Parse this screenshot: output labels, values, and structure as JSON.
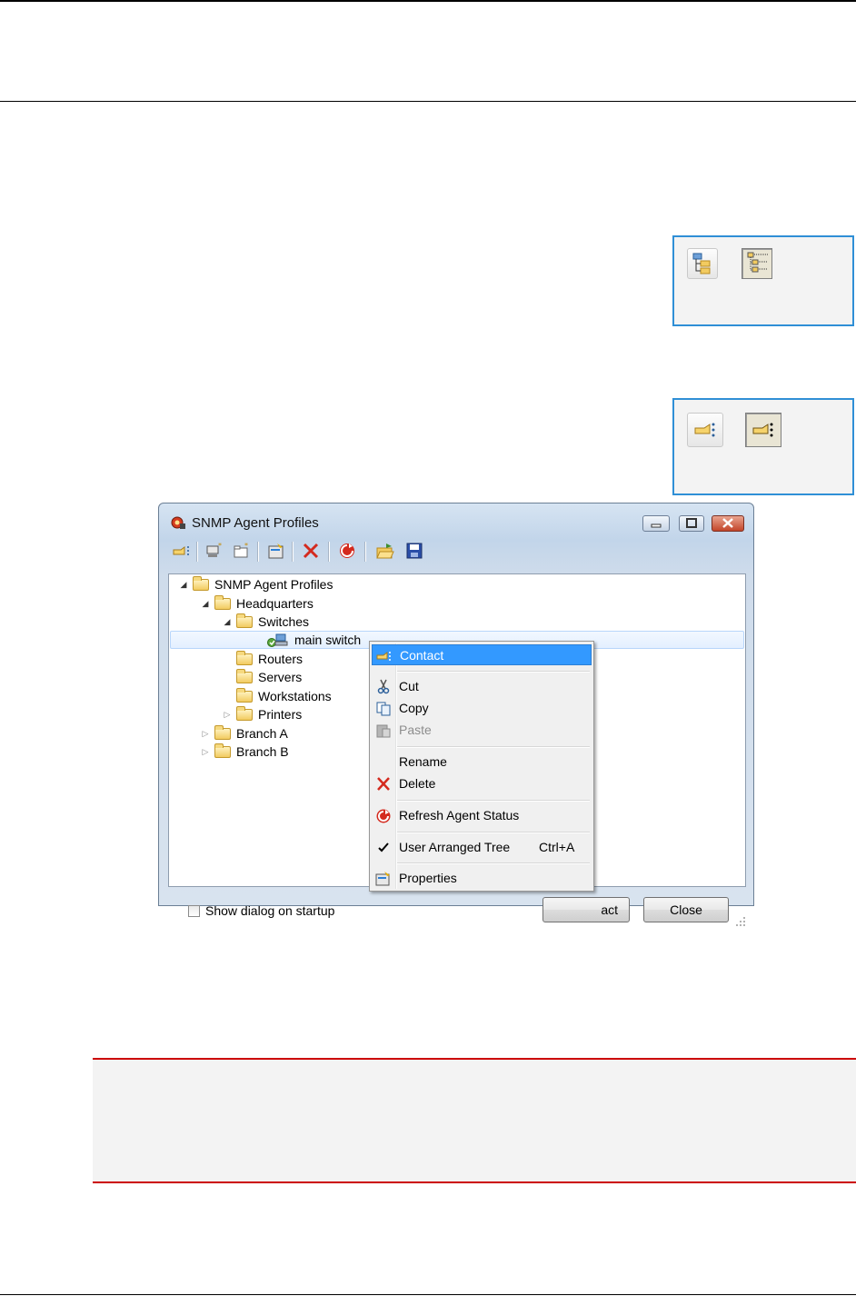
{
  "window": {
    "title": "SNMP Agent Profiles",
    "icons": [
      "snmp-agent-icon",
      "minimize-icon",
      "maximize-icon",
      "close-icon"
    ]
  },
  "toolbar": {
    "icons": [
      "contact-icon",
      "new-agent-icon",
      "new-folder-icon",
      "properties-icon",
      "delete-icon",
      "refresh-icon",
      "open-icon",
      "save-icon"
    ]
  },
  "tree": {
    "root": "SNMP Agent Profiles",
    "headquarters": "Headquarters",
    "switches": "Switches",
    "main_switch": "main switch",
    "routers": "Routers",
    "servers": "Servers",
    "workstations": "Workstations",
    "printers": "Printers",
    "branch_a": "Branch A",
    "branch_b": "Branch B"
  },
  "bottom": {
    "show_dialog_label": "Show dialog on startup",
    "contact_button_partial": "act",
    "close_button": "Close"
  },
  "context_menu": {
    "contact": "Contact",
    "cut": "Cut",
    "copy": "Copy",
    "paste": "Paste",
    "rename": "Rename",
    "delete": "Delete",
    "refresh_agent_status": "Refresh Agent Status",
    "user_arranged_tree": "User Arranged Tree",
    "user_arranged_tree_shortcut": "Ctrl+A",
    "properties": "Properties"
  },
  "colors": {
    "sidebox_border": "#2f8fd6",
    "note_border": "#cc0000",
    "menu_highlight": "#3399ff"
  },
  "side_icons": [
    "tree-view-icon",
    "tree-view-pressed-icon",
    "contact-icon",
    "contact-pressed-icon"
  ]
}
